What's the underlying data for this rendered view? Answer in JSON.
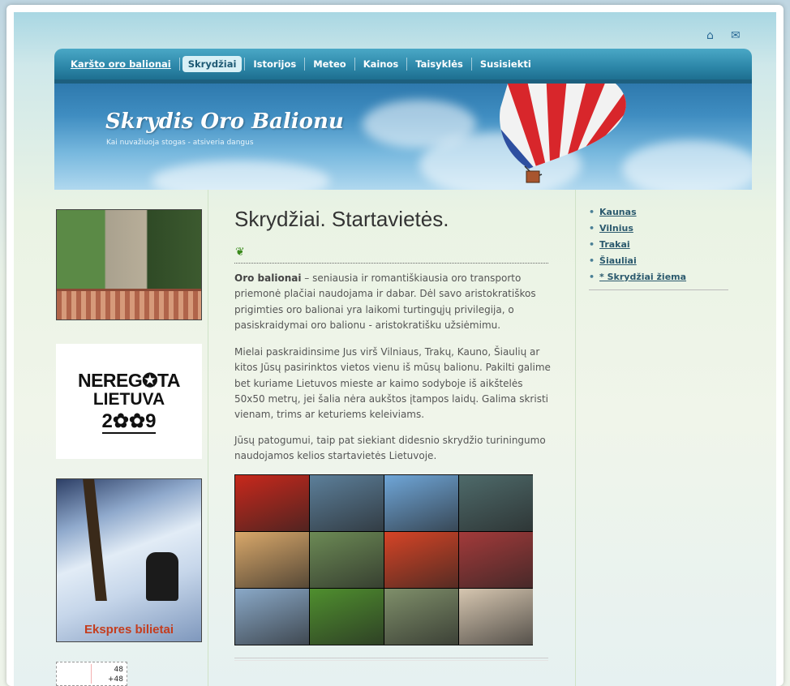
{
  "top_icons": [
    {
      "name": "home-icon",
      "glyph": "⌂"
    },
    {
      "name": "mail-icon",
      "glyph": "✉"
    }
  ],
  "nav": {
    "items": [
      {
        "label": "Karšto oro balionai",
        "type": "home"
      },
      {
        "label": "Skrydžiai",
        "type": "active"
      },
      {
        "label": "Istorijos",
        "type": "normal"
      },
      {
        "label": "Meteo",
        "type": "normal"
      },
      {
        "label": "Kainos",
        "type": "normal"
      },
      {
        "label": "Taisyklės",
        "type": "normal"
      },
      {
        "label": "Susisiekti",
        "type": "normal"
      }
    ]
  },
  "banner": {
    "title": "Skrydis Oro Balionu",
    "subtitle": "Kai nuvažiuoja stogas - atsiveria dangus"
  },
  "left": {
    "logo": {
      "line1": "NEREG✪TA",
      "line2": "LIETUVA",
      "line3": "2✿✿9"
    },
    "ad_caption": "Ekspres bilietai",
    "counter": {
      "line1": "48",
      "line2": "+48"
    }
  },
  "main": {
    "title": "Skrydžiai. Startavietės.",
    "p1_bold": "Oro balionai",
    "p1_text": " – seniausia ir romantiškiausia oro transporto priemonė plačiai naudojama ir dabar. Dėl savo aristokratiškos prigimties oro balionai yra laikomi turtingųjų privilegija, o pasiskraidymai oro balionu - aristokratišku užsiėmimu.",
    "p2": "Mielai paskraidinsime Jus virš Vilniaus, Trakų, Kauno, Šiaulių ar kitos Jūsų pasirinktos vietos vienu iš mūsų balionu. Pakilti galime bet kuriame Lietuvos mieste ar kaimo sodyboje iš aikštelės 50x50 metrų, jei šalia nėra aukštos įtampos laidų. Galima skristi vienam, trims ar keturiems keleiviams.",
    "p3": "Jūsų patogumui, taip pat siekiant didesnio skrydžio turiningumo naudojamos kelios startavietės Lietuvoje."
  },
  "gallery_colors": [
    "#c8281c",
    "#5c7f9a",
    "#6fa6d8",
    "#4e6a6a",
    "#d9a86a",
    "#6c8a55",
    "#d64426",
    "#a33a3a",
    "#8aa9c8",
    "#4f8f2e",
    "#7f8f6a",
    "#d6c6b0"
  ],
  "right": {
    "links": [
      "Kaunas",
      "Vilnius",
      "Trakai",
      "Šiauliai",
      "* Skrydžiai žiema"
    ]
  }
}
